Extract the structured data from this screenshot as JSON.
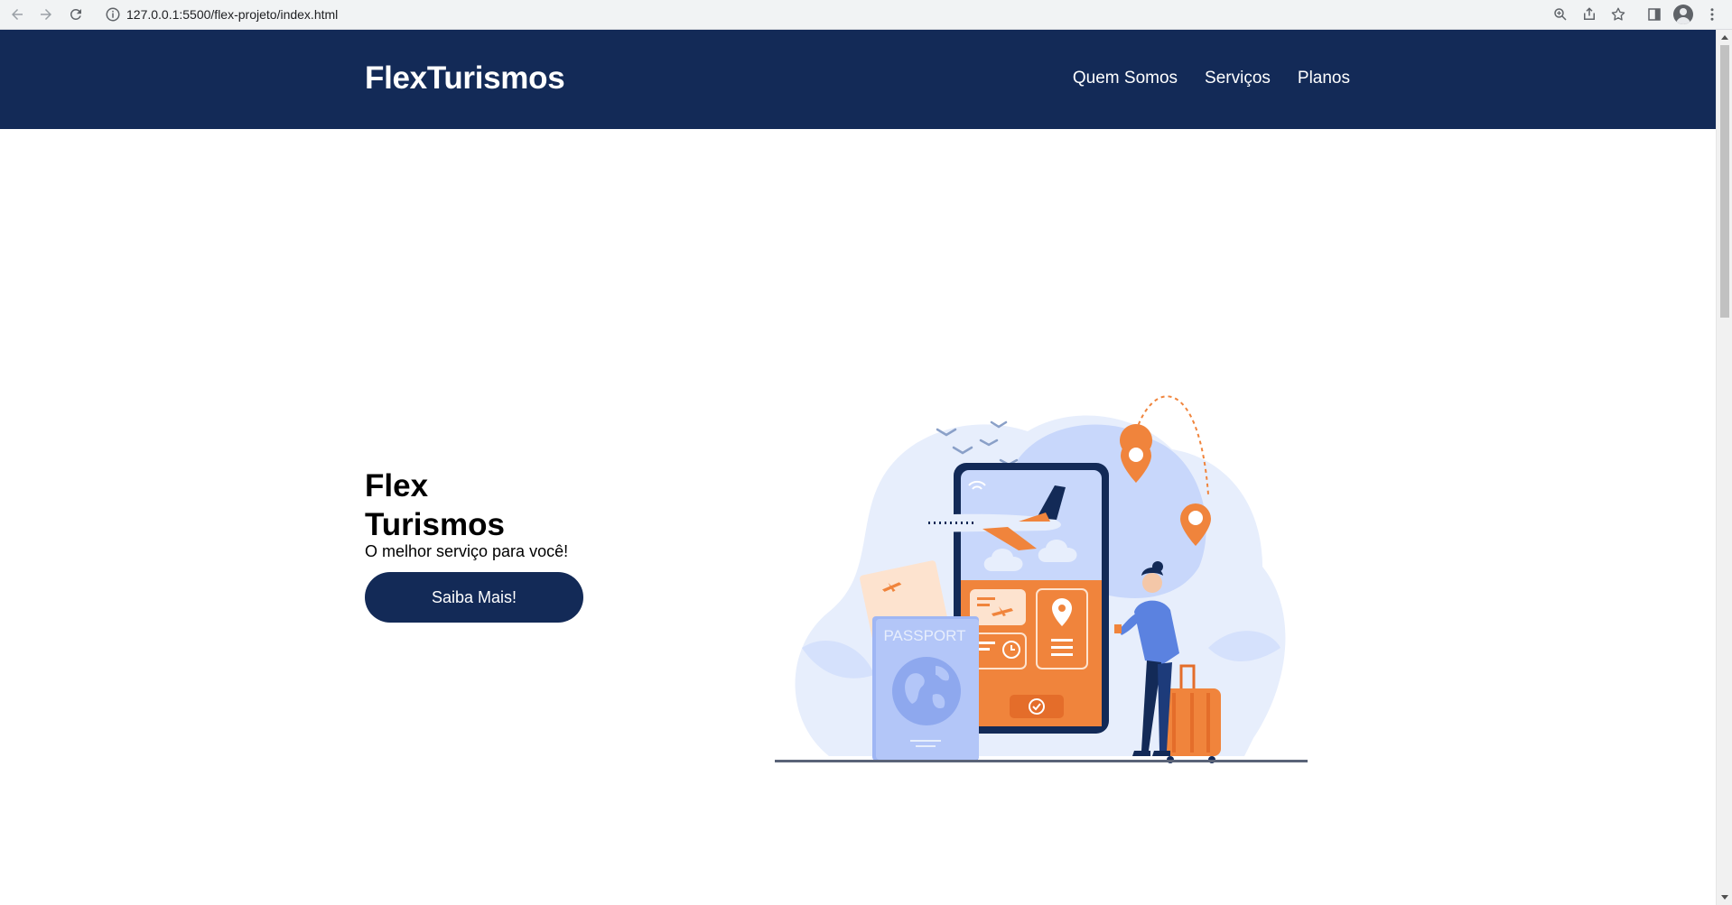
{
  "browser": {
    "url": "127.0.0.1:5500/flex-projeto/index.html"
  },
  "header": {
    "logo": "FlexTurismos",
    "nav": [
      "Quem Somos",
      "Serviços",
      "Planos"
    ]
  },
  "hero": {
    "title_line1": "Flex",
    "title_line2": "Turismos",
    "subtitle": "O melhor serviço para você!",
    "button_label": "Saiba Mais!"
  },
  "illustration": {
    "passport_label": "PASSPORT"
  },
  "colors": {
    "brand_navy": "#132a57",
    "accent_orange": "#f0843c",
    "light_blue": "#c8d7fb"
  }
}
